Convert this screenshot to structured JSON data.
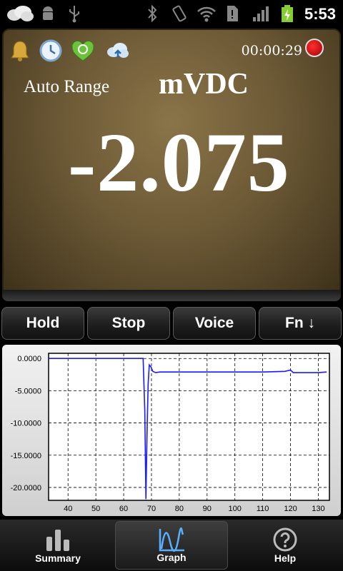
{
  "status_bar": {
    "time": "5:53",
    "icons": [
      "weather-cloud-icon",
      "android-debug-icon",
      "usb-icon",
      "bluetooth-icon",
      "vibrate-icon",
      "wifi-icon",
      "sim-alert-icon",
      "signal-icon",
      "battery-charging-icon"
    ]
  },
  "meter": {
    "timer": "00:00:29",
    "range": "Auto Range",
    "unit": "mVDC",
    "reading": "-2.075",
    "top_icons": [
      "bell-icon",
      "clock-icon",
      "recycle-heart-icon",
      "cloud-upload-icon"
    ],
    "record_icon": "record-icon"
  },
  "buttons": {
    "hold": "Hold",
    "stop": "Stop",
    "voice": "Voice",
    "fn": "Fn ↓"
  },
  "chart_data": {
    "type": "line",
    "xlim": [
      33,
      134
    ],
    "ylim": [
      -22,
      0.8
    ],
    "x_ticks": [
      "40",
      "50",
      "60",
      "70",
      "80",
      "90",
      "100",
      "110",
      "120",
      "130"
    ],
    "y_ticks": [
      "0.0000",
      "-5.0000",
      "-10.0000",
      "-15.0000",
      "-20.0000"
    ],
    "x_tick_values": [
      40,
      50,
      60,
      70,
      80,
      90,
      100,
      110,
      120,
      130
    ],
    "y_tick_values": [
      0,
      -5,
      -10,
      -15,
      -20
    ],
    "grid": true,
    "series": [
      {
        "color": "#1a1aff",
        "x": [
          33,
          45,
          55,
          60,
          67,
          67.6,
          68,
          68.4,
          68.8,
          69.2,
          69.8,
          70.5,
          71.5,
          73,
          80,
          90,
          100,
          110,
          118,
          120,
          121,
          125,
          130,
          133
        ],
        "y": [
          0.0,
          0.0,
          0.0,
          0.0,
          0.0,
          -8,
          -21.8,
          -12,
          -4,
          -1.0,
          -1.3,
          -2.0,
          -2.2,
          -2.1,
          -2.1,
          -2.1,
          -2.1,
          -2.1,
          -2.0,
          -1.8,
          -2.2,
          -2.2,
          -2.2,
          -2.1
        ]
      }
    ]
  },
  "tabs": {
    "summary": "Summary",
    "graph": "Graph",
    "help": "Help"
  }
}
